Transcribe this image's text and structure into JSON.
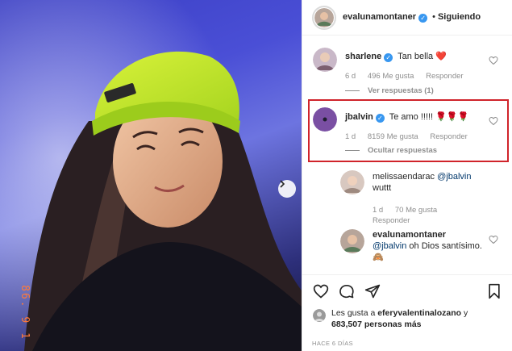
{
  "post": {
    "author": "evalunamontaner",
    "follow_status": "Siguiendo",
    "separator": "•",
    "date_stamp": "86. 9 1",
    "time_ago": "HACE 6 DÍAS"
  },
  "comments": [
    {
      "username": "sharlene",
      "verified": true,
      "text": "Tan bella",
      "emoji": "❤️",
      "time": "6 d",
      "likes": "496 Me gusta",
      "reply": "Responder",
      "thread_toggle": "Ver respuestas (1)"
    },
    {
      "username": "jbalvin",
      "verified": true,
      "text": "Te amo !!!!!",
      "emoji": "🌹🌹🌹",
      "time": "1 d",
      "likes": "8159 Me gusta",
      "reply": "Responder",
      "thread_toggle": "Ocultar respuestas"
    }
  ],
  "replies": [
    {
      "username": "melissaendarac",
      "mention": "@jbalvin",
      "text": "wuttt",
      "time": "1 d",
      "likes": "70 Me gusta",
      "reply": "Responder"
    },
    {
      "username": "evalunamontaner",
      "mention": "@jbalvin",
      "text": "oh Dios santísimo.",
      "emoji": "🙈"
    }
  ],
  "footer": {
    "likes_text_prefix": "Les gusta a",
    "likes_user": "eferyvalentinalozano",
    "likes_text_suffix": "y",
    "likes_count": "683,507",
    "likes_text_end": "personas más"
  },
  "colors": {
    "accent": "#3897f0",
    "highlight": "#d0242b",
    "meta": "#8e8e8e"
  },
  "icons": [
    "heart-icon",
    "comment-icon",
    "share-icon",
    "bookmark-icon",
    "verified-icon",
    "chevron-right-icon"
  ]
}
